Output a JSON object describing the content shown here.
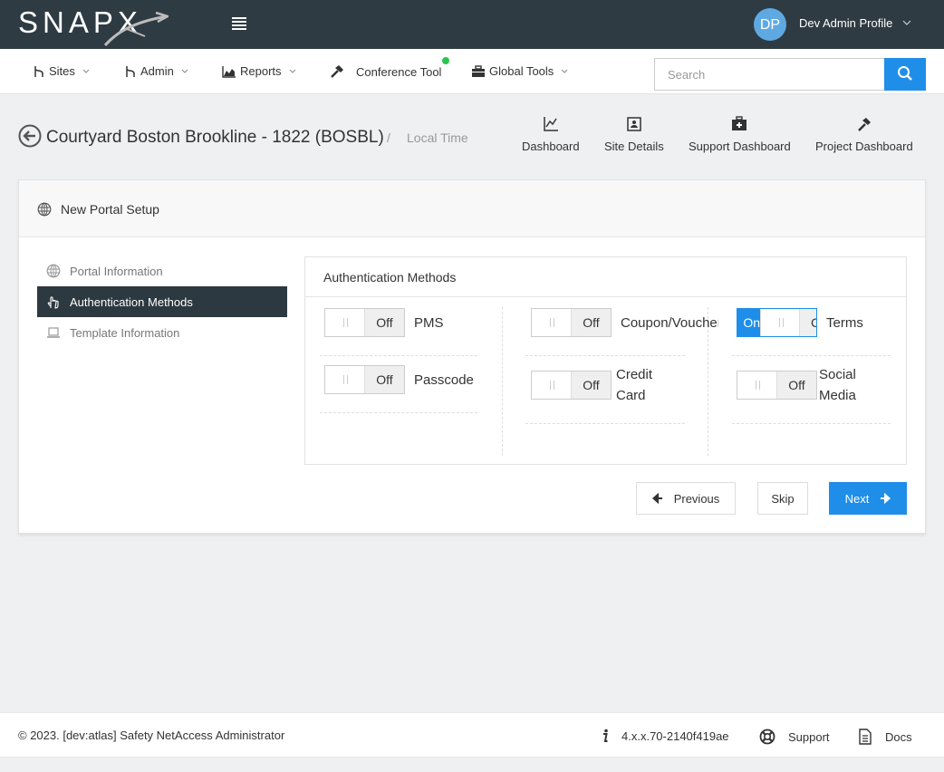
{
  "brand": {
    "logo_text": "SNAPX"
  },
  "header": {
    "profile_initials": "DP",
    "profile_name": "Dev Admin Profile"
  },
  "nav": {
    "items": [
      {
        "label": "Sites"
      },
      {
        "label": "Admin"
      },
      {
        "label": "Reports"
      },
      {
        "label": "Conference Tool"
      },
      {
        "label": "Global Tools"
      }
    ],
    "search_placeholder": "Search"
  },
  "site": {
    "title": "Courtyard Boston Brookline - 1822 (BOSBL)",
    "separator": "/",
    "time_label": "Local Time",
    "quick_links": [
      {
        "label": "Dashboard"
      },
      {
        "label": "Site Details"
      },
      {
        "label": "Support Dashboard"
      },
      {
        "label": "Project Dashboard"
      }
    ]
  },
  "panel": {
    "title": "New Portal Setup",
    "steps": [
      {
        "label": "Portal Information"
      },
      {
        "label": "Authentication Methods"
      },
      {
        "label": "Template Information"
      }
    ],
    "auth": {
      "title": "Authentication Methods",
      "methods": [
        {
          "label": "PMS",
          "state": "Off"
        },
        {
          "label": "Passcode",
          "state": "Off"
        },
        {
          "label": "Coupon/Voucher",
          "state": "Off"
        },
        {
          "label": "Credit Card",
          "state": "Off"
        },
        {
          "label": "Terms",
          "state": "On",
          "off_label": "C"
        },
        {
          "label": "Social Media",
          "state": "Off"
        }
      ]
    },
    "buttons": {
      "previous": "Previous",
      "skip": "Skip",
      "next": "Next"
    }
  },
  "footer": {
    "copyright": "© 2023. [dev:atlas] Safety NetAccess Administrator",
    "version": "4.x.x.70-2140f419ae",
    "support": "Support",
    "docs": "Docs"
  },
  "colors": {
    "topbar": "#2f3b43",
    "accent": "#1e8ee8",
    "active_step": "#2d3940",
    "nav_dot": "#2bc44f"
  }
}
